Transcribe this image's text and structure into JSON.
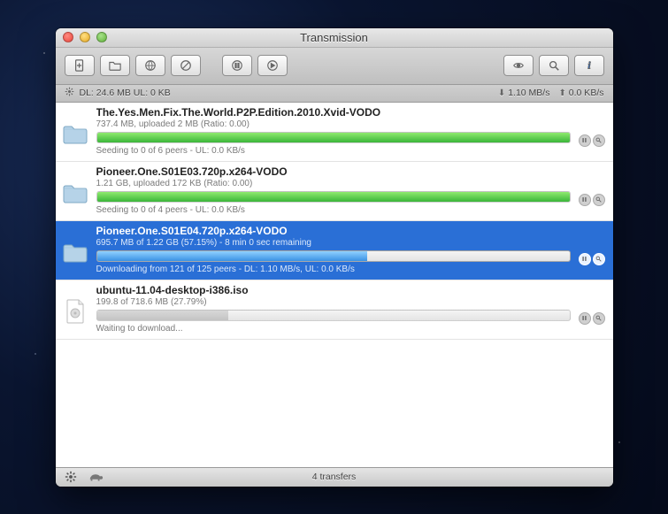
{
  "window": {
    "title": "Transmission"
  },
  "status": {
    "left": "DL: 24.6 MB  UL: 0 KB",
    "dn": "1.10 MB/s",
    "up": "0.0 KB/s"
  },
  "transfers": [
    {
      "icon": "folder",
      "name": "The.Yes.Men.Fix.The.World.P2P.Edition.2010.Xvid-VODO",
      "sub": "737.4 MB, uploaded 2 MB (Ratio: 0.00)",
      "progress": 100,
      "fill": "green",
      "peers": "Seeding to 0 of 6 peers - UL: 0.0 KB/s",
      "selected": false
    },
    {
      "icon": "folder",
      "name": "Pioneer.One.S01E03.720p.x264-VODO",
      "sub": "1.21 GB, uploaded 172 KB (Ratio: 0.00)",
      "progress": 100,
      "fill": "green",
      "peers": "Seeding to 0 of 4 peers - UL: 0.0 KB/s",
      "selected": false
    },
    {
      "icon": "folder",
      "name": "Pioneer.One.S01E04.720p.x264-VODO",
      "sub": "695.7 MB of 1.22 GB (57.15%) - 8 min 0 sec remaining",
      "progress": 57.15,
      "fill": "blue",
      "peers": "Downloading from 121 of 125 peers - DL: 1.10 MB/s, UL: 0.0 KB/s",
      "selected": true
    },
    {
      "icon": "file",
      "name": "ubuntu-11.04-desktop-i386.iso",
      "sub": "199.8 of 718.6 MB (27.79%)",
      "progress": 27.79,
      "fill": "grey",
      "peers": "Waiting to download...",
      "selected": false
    }
  ],
  "footer": {
    "count": "4 transfers"
  },
  "icons": {
    "open": "open-file-icon",
    "folder": "open-folder-icon",
    "web": "globe-icon",
    "block": "blocklist-icon",
    "pause": "pause-all-icon",
    "resume": "resume-all-icon",
    "reveal": "reveal-icon",
    "search": "search-icon",
    "info": "info-icon"
  }
}
